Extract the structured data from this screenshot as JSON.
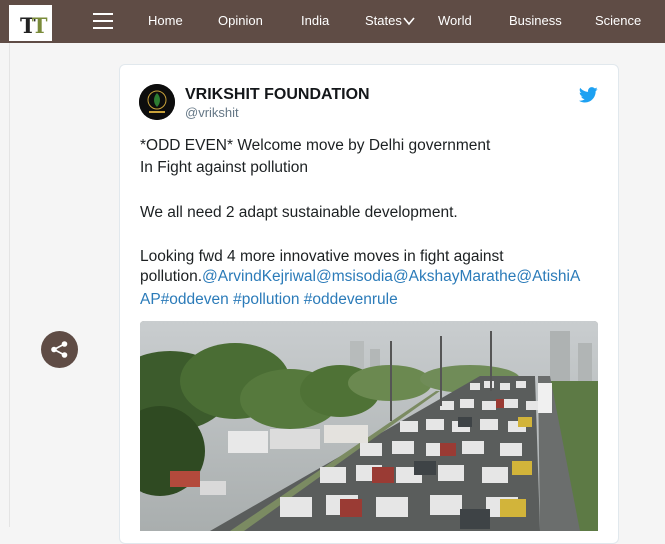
{
  "header": {
    "logo": "TT",
    "nav": [
      "Home",
      "Opinion",
      "India",
      "States",
      "World",
      "Business",
      "Science"
    ],
    "colors": {
      "bar": "#5f4c45",
      "logo_accent": "#7a8b3a"
    }
  },
  "share": {
    "icon": "share-icon"
  },
  "tweet": {
    "name": "VRIKSHIT FOUNDATION",
    "handle": "@vrikshit",
    "line1": "*ODD EVEN*  Welcome move by Delhi government",
    "line2": "In Fight against pollution",
    "line3": "We all need 2  adapt sustainable development.",
    "line4": "Looking fwd  4 more innovative moves in fight against",
    "line5_text": "pollution.",
    "mentions": [
      "@ArvindKejriwal",
      "@msisodia",
      "@AkshayMarathe",
      "@AtishiA"
    ],
    "line6_mention_tail": "AP",
    "hashtags": [
      "#oddeven",
      "#pollution",
      "#oddevenrule"
    ],
    "image_alt": "Traffic jam on a multi-lane highway",
    "colors": {
      "link": "#2b7bb9",
      "bird": "#1da1f2"
    }
  }
}
